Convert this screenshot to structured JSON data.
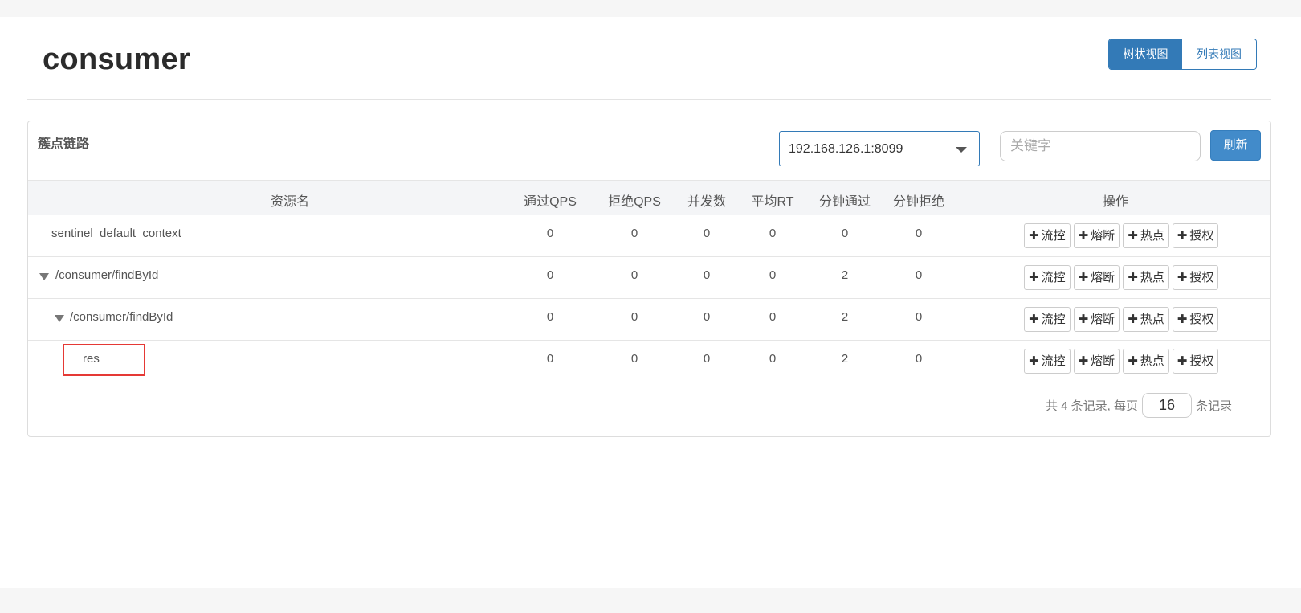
{
  "app": {
    "title": "consumer"
  },
  "view_toggle": {
    "tree_label": "树状视图",
    "list_label": "列表视图"
  },
  "panel": {
    "title": "簇点链路",
    "machine_select": {
      "value": "192.168.126.1:8099"
    },
    "search": {
      "placeholder": "关键字",
      "value": ""
    },
    "refresh_label": "刷新"
  },
  "table": {
    "headers": [
      "资源名",
      "通过QPS",
      "拒绝QPS",
      "并发数",
      "平均RT",
      "分钟通过",
      "分钟拒绝",
      "操作"
    ],
    "rows": [
      {
        "name": "sentinel_default_context",
        "expanded": null,
        "pass_qps": "0",
        "block_qps": "0",
        "concurrency": "0",
        "avg_rt": "0",
        "minute_pass": "0",
        "minute_block": "0"
      },
      {
        "name": "/consumer/findById",
        "expanded": true,
        "pass_qps": "0",
        "block_qps": "0",
        "concurrency": "0",
        "avg_rt": "0",
        "minute_pass": "2",
        "minute_block": "0"
      },
      {
        "name": "/consumer/findById",
        "expanded": true,
        "pass_qps": "0",
        "block_qps": "0",
        "concurrency": "0",
        "avg_rt": "0",
        "minute_pass": "2",
        "minute_block": "0"
      },
      {
        "name": "res",
        "expanded": null,
        "highlighted": true,
        "pass_qps": "0",
        "block_qps": "0",
        "concurrency": "0",
        "avg_rt": "0",
        "minute_pass": "2",
        "minute_block": "0"
      }
    ],
    "actions": [
      "流控",
      "熔断",
      "热点",
      "授权"
    ]
  },
  "pagination": {
    "prefix": "共 4 条记录, 每页",
    "page_size": "16",
    "suffix": "条记录"
  },
  "colors": {
    "primary": "#337ab7",
    "button": "#428bca",
    "highlight": "#e53935"
  }
}
